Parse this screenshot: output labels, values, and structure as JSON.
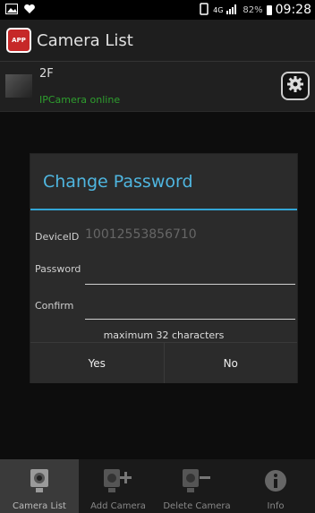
{
  "status_bar": {
    "network": "4G",
    "battery": "82%",
    "time": "09:28"
  },
  "app": {
    "logo_text": "APP",
    "title": "Camera List"
  },
  "camera": {
    "name": "2F",
    "status": "IPCamera online"
  },
  "dialog": {
    "title": "Change Password",
    "device_id_label": "DeviceID",
    "device_id_value": "10012553856710",
    "password_label": "Password",
    "password_value": "",
    "confirm_label": "Confirm",
    "confirm_value": "",
    "hint": "maximum 32 characters",
    "yes_label": "Yes",
    "no_label": "No"
  },
  "tabs": [
    {
      "label": "Camera List",
      "icon": "camera-icon",
      "active": true
    },
    {
      "label": "Add Camera",
      "icon": "add-camera-icon",
      "active": false
    },
    {
      "label": "Delete Camera",
      "icon": "delete-camera-icon",
      "active": false
    },
    {
      "label": "Info",
      "icon": "info-icon",
      "active": false
    }
  ],
  "colors": {
    "accent": "#33a6d6",
    "online": "#2e9e2e",
    "logo": "#c62828"
  }
}
